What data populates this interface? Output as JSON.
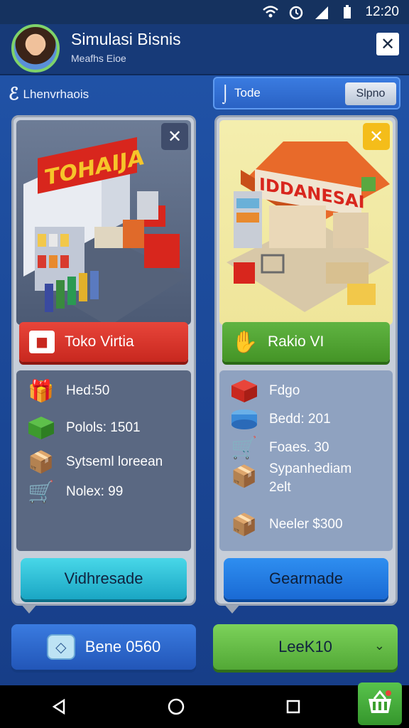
{
  "status": {
    "time": "12:20",
    "icons": [
      "wifi-icon",
      "alarm-icon",
      "signal-icon",
      "battery-icon"
    ]
  },
  "header": {
    "title": "Simulasi Bisnis",
    "subtitle": "Meafhs Eioe"
  },
  "section_left": {
    "label": "Lhenvrhaois"
  },
  "section_right": {
    "label": "Tode",
    "button": "Slpno"
  },
  "card_left": {
    "sign": "TOHAIJA",
    "banner": "Toko Virtia",
    "stats": [
      {
        "text": "Hed:50",
        "icon": "gift-box-icon"
      },
      {
        "text": "Polols: 1501",
        "icon": "green-box-icon"
      },
      {
        "text": "Sytseml loreean",
        "icon": "cardboard-box-icon"
      },
      {
        "text": "Nolex: 99",
        "icon": "red-cart-icon"
      }
    ],
    "action": "Vidhresade"
  },
  "card_right": {
    "sign": "IDDANESAI",
    "banner": "Rakio VI",
    "stats": [
      {
        "text": "Fdgo",
        "icon": "red-crate-icon"
      },
      {
        "text": "Bedd: 201",
        "icon": "blue-can-icon"
      },
      {
        "text": "Foaes. 30",
        "icon": "green-cart-icon"
      },
      {
        "text": "Sypanhediam",
        "icon": "parcel-icon"
      },
      {
        "text": "2elt",
        "icon": "parcel-icon"
      },
      {
        "text": "Neeler $300",
        "icon": "produce-box-icon"
      }
    ],
    "action": "Gearmade"
  },
  "bottom": {
    "left": "Bene 0560",
    "right": "LeeK10"
  },
  "colors": {
    "accent_red": "#d9352b",
    "accent_green": "#5aae3a",
    "accent_blue": "#2a78e4",
    "accent_cyan": "#2fbfd8"
  }
}
